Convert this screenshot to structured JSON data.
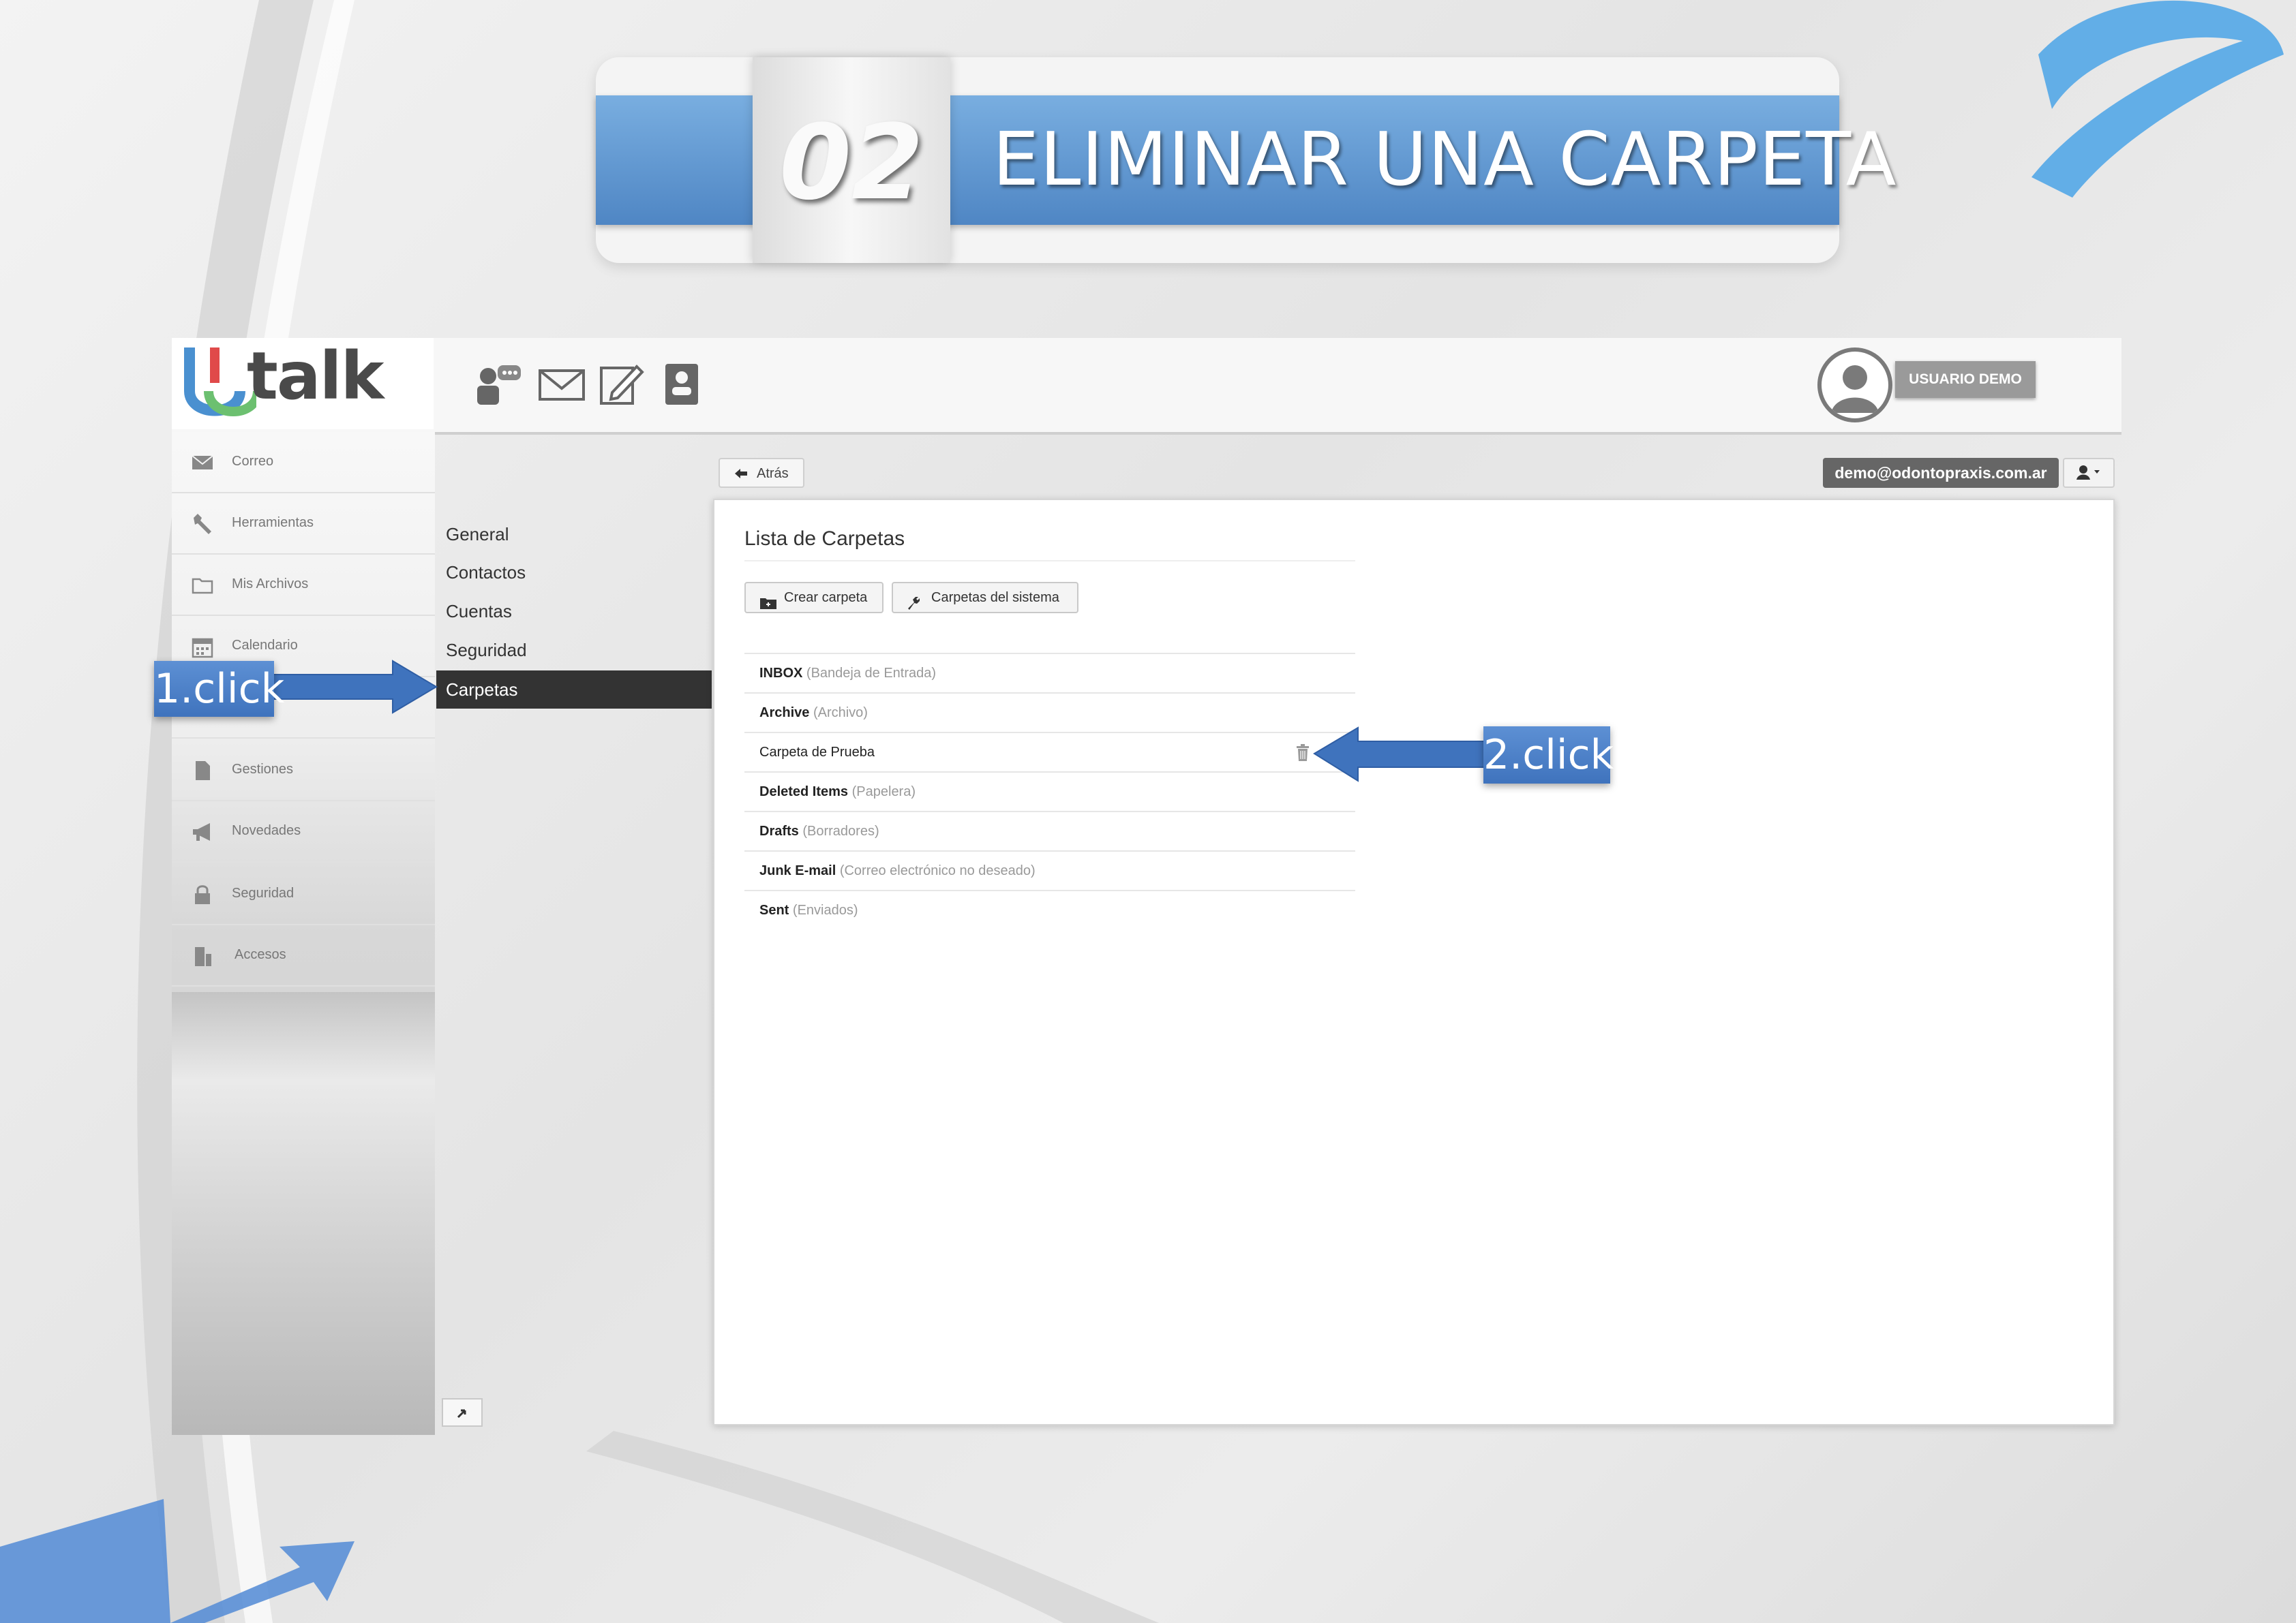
{
  "banner": {
    "number": "02",
    "title": "ELIMINAR UNA CARPETA"
  },
  "app": {
    "logo_text": "talk",
    "user_label": "USUARIO DEMO",
    "account_email": "demo@odontopraxis.com.ar"
  },
  "toolbar": {
    "icons": [
      "contacts-chat-icon",
      "mail-envelope-icon",
      "compose-edit-icon",
      "address-book-icon"
    ]
  },
  "sidebar": {
    "items": [
      {
        "label": "Correo",
        "icon": "mail-icon"
      },
      {
        "label": "Herramientas",
        "icon": "wrench-icon"
      },
      {
        "label": "Mis Archivos",
        "icon": "folder-icon"
      },
      {
        "label": "Calendario",
        "icon": "calendar-icon"
      },
      {
        "label": "",
        "icon": "hidden-icon"
      },
      {
        "label": "Gestiones",
        "icon": "document-icon"
      },
      {
        "label": "Novedades",
        "icon": "megaphone-icon"
      },
      {
        "label": "Seguridad",
        "icon": "lock-icon"
      },
      {
        "label": "Accesos",
        "icon": "door-icon"
      }
    ]
  },
  "settings_nav": {
    "items": [
      "General",
      "Contactos",
      "Cuentas",
      "Seguridad",
      "Carpetas"
    ],
    "active": "Carpetas"
  },
  "actions": {
    "back_label": "Atrás"
  },
  "folders_panel": {
    "title": "Lista de Carpetas",
    "create_button": "Crear carpeta",
    "system_button": "Carpetas del sistema",
    "folders": [
      {
        "name": "INBOX",
        "desc": "(Bandeja de Entrada)",
        "system": true
      },
      {
        "name": "Archive",
        "desc": "(Archivo)",
        "system": true
      },
      {
        "name": "Carpeta de Prueba",
        "desc": "",
        "system": false
      },
      {
        "name": "Deleted Items",
        "desc": "(Papelera)",
        "system": true
      },
      {
        "name": "Drafts",
        "desc": "(Borradores)",
        "system": true
      },
      {
        "name": "Junk E-mail",
        "desc": "(Correo electrónico no deseado)",
        "system": true
      },
      {
        "name": "Sent",
        "desc": "(Enviados)",
        "system": true
      }
    ]
  },
  "annotations": {
    "step1": "1.click",
    "step2": "2.click"
  },
  "colors": {
    "accent_blue": "#4f86c4",
    "nav_active": "#333333",
    "email_chip": "#666666"
  }
}
